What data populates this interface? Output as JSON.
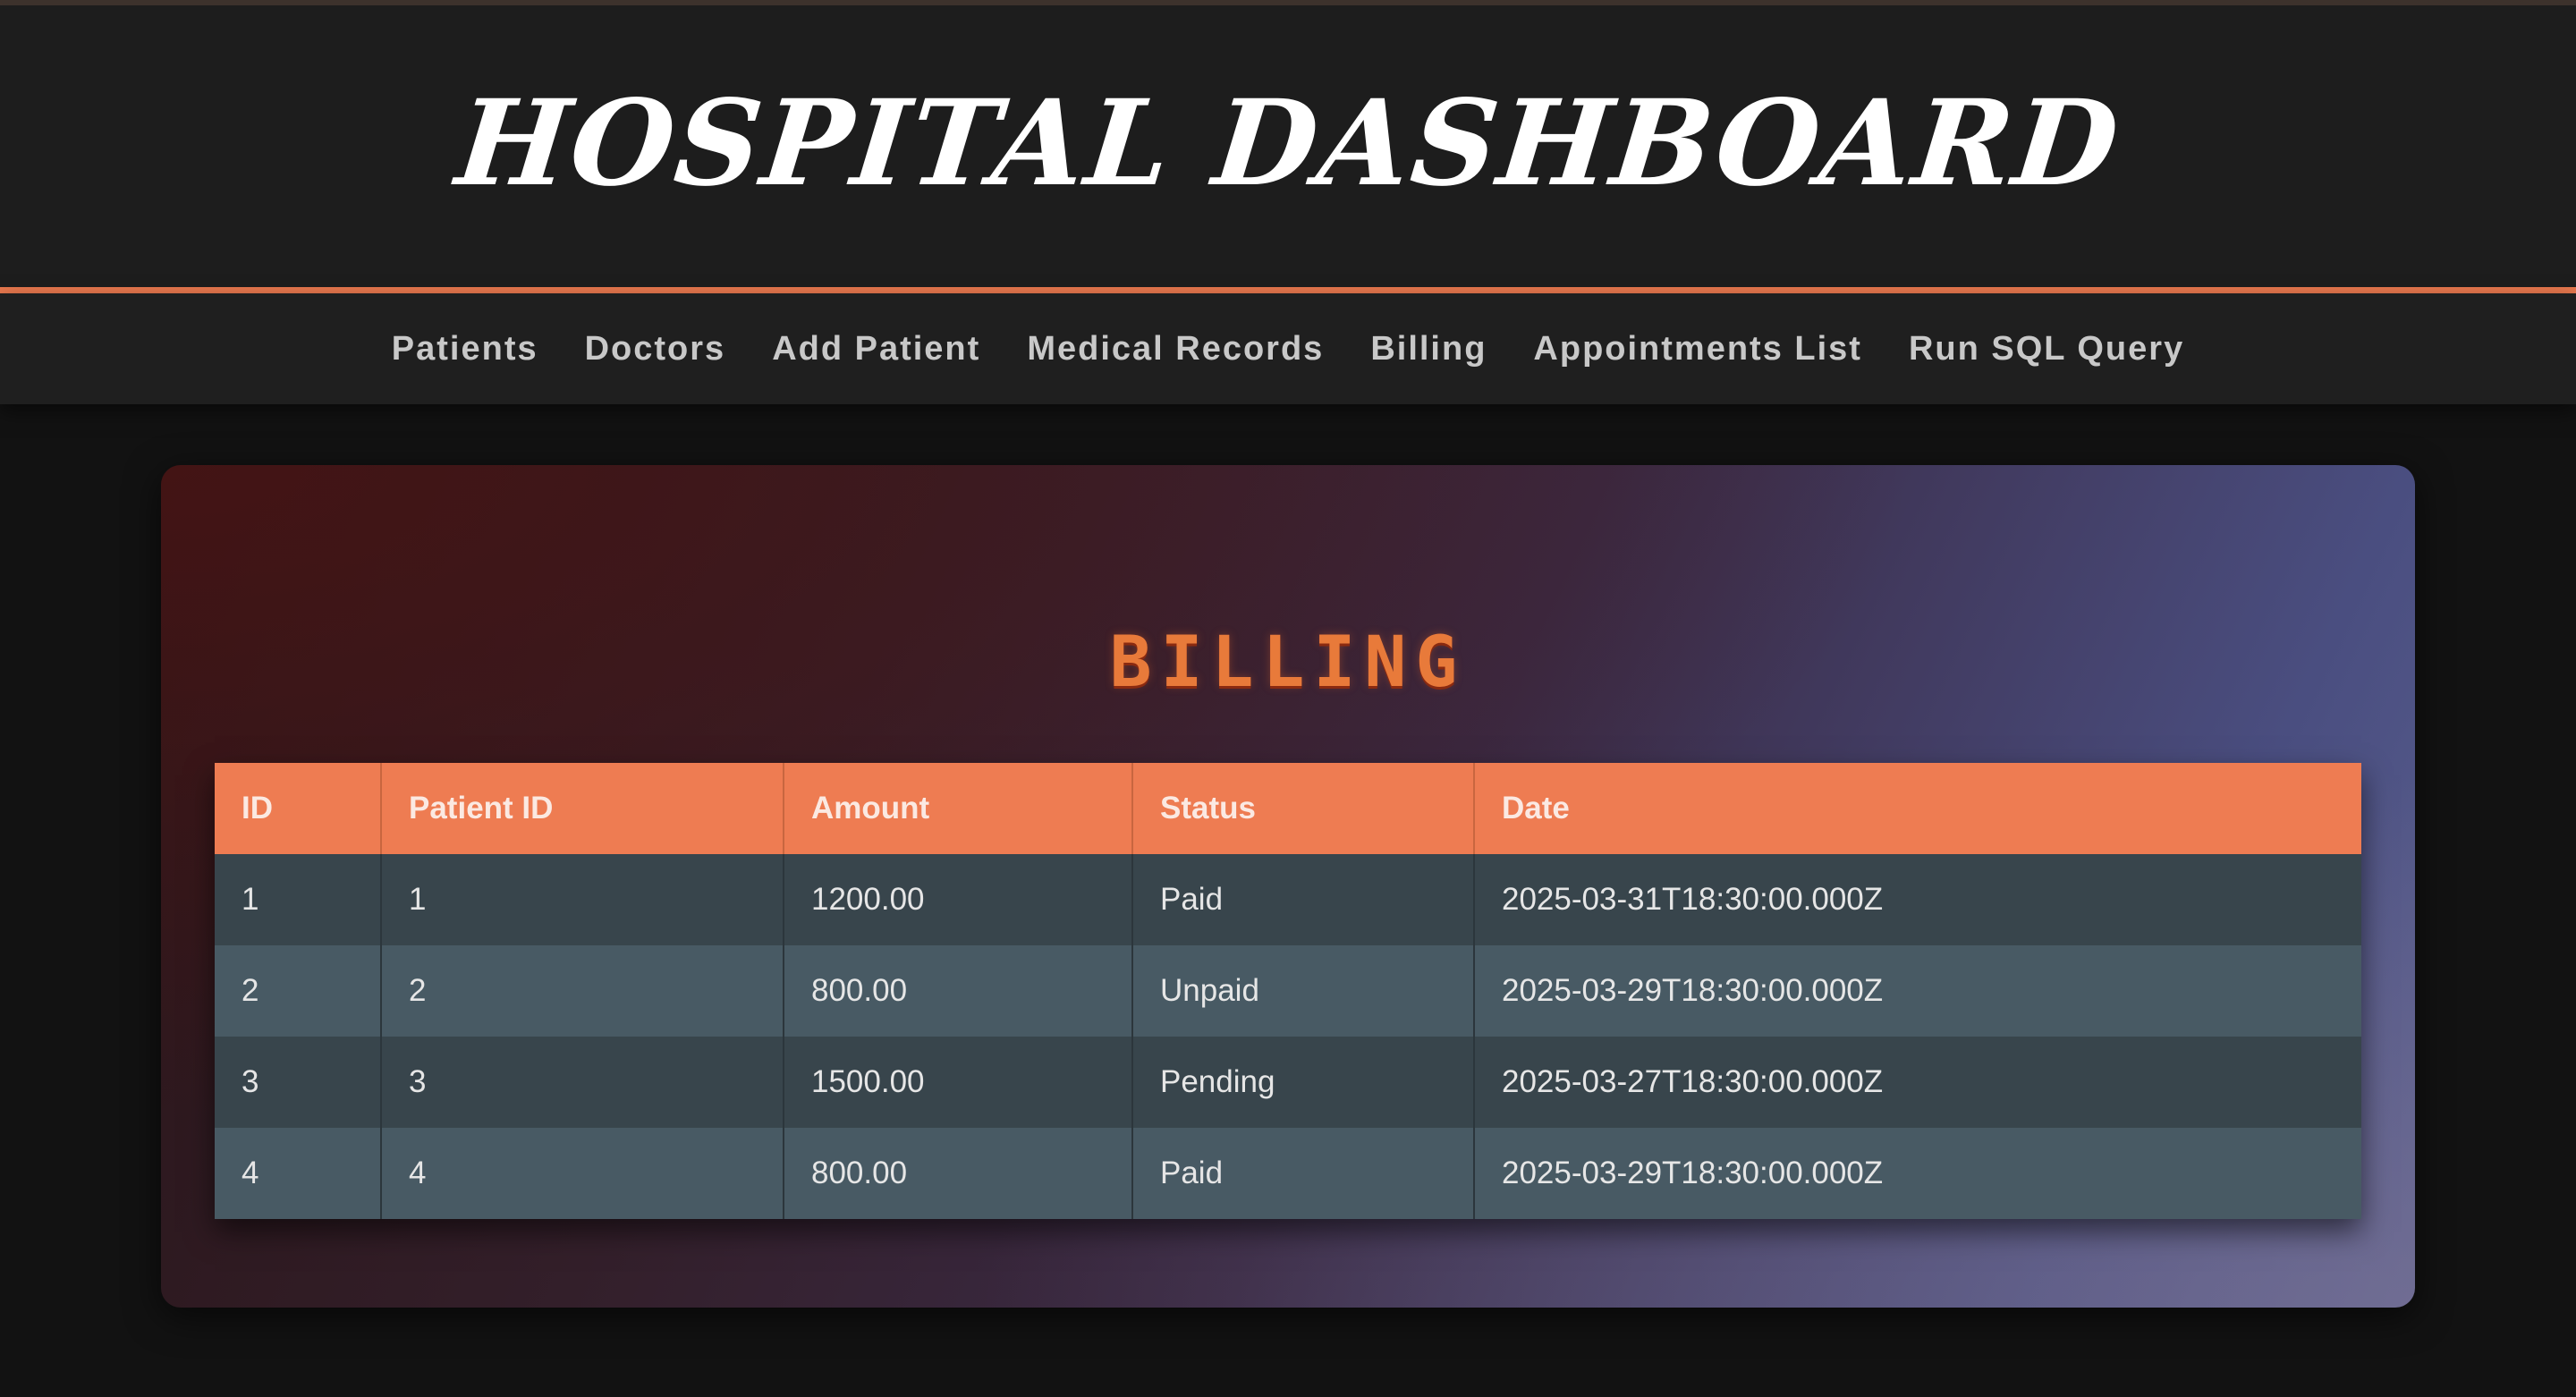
{
  "header": {
    "title": "HOSPITAL DASHBOARD"
  },
  "nav": {
    "items": [
      "Patients",
      "Doctors",
      "Add Patient",
      "Medical Records",
      "Billing",
      "Appointments List",
      "Run SQL Query"
    ]
  },
  "billing": {
    "title": "BILLING",
    "columns": [
      "ID",
      "Patient ID",
      "Amount",
      "Status",
      "Date"
    ],
    "rows": [
      [
        "1",
        "1",
        "1200.00",
        "Paid",
        "2025-03-31T18:30:00.000Z"
      ],
      [
        "2",
        "2",
        "800.00",
        "Unpaid",
        "2025-03-29T18:30:00.000Z"
      ],
      [
        "3",
        "3",
        "1500.00",
        "Pending",
        "2025-03-27T18:30:00.000Z"
      ],
      [
        "4",
        "4",
        "800.00",
        "Paid",
        "2025-03-29T18:30:00.000Z"
      ]
    ]
  },
  "colors": {
    "accent": "#ee7c52",
    "header_bg": "#1d1d1d",
    "page_bg": "#121212"
  }
}
